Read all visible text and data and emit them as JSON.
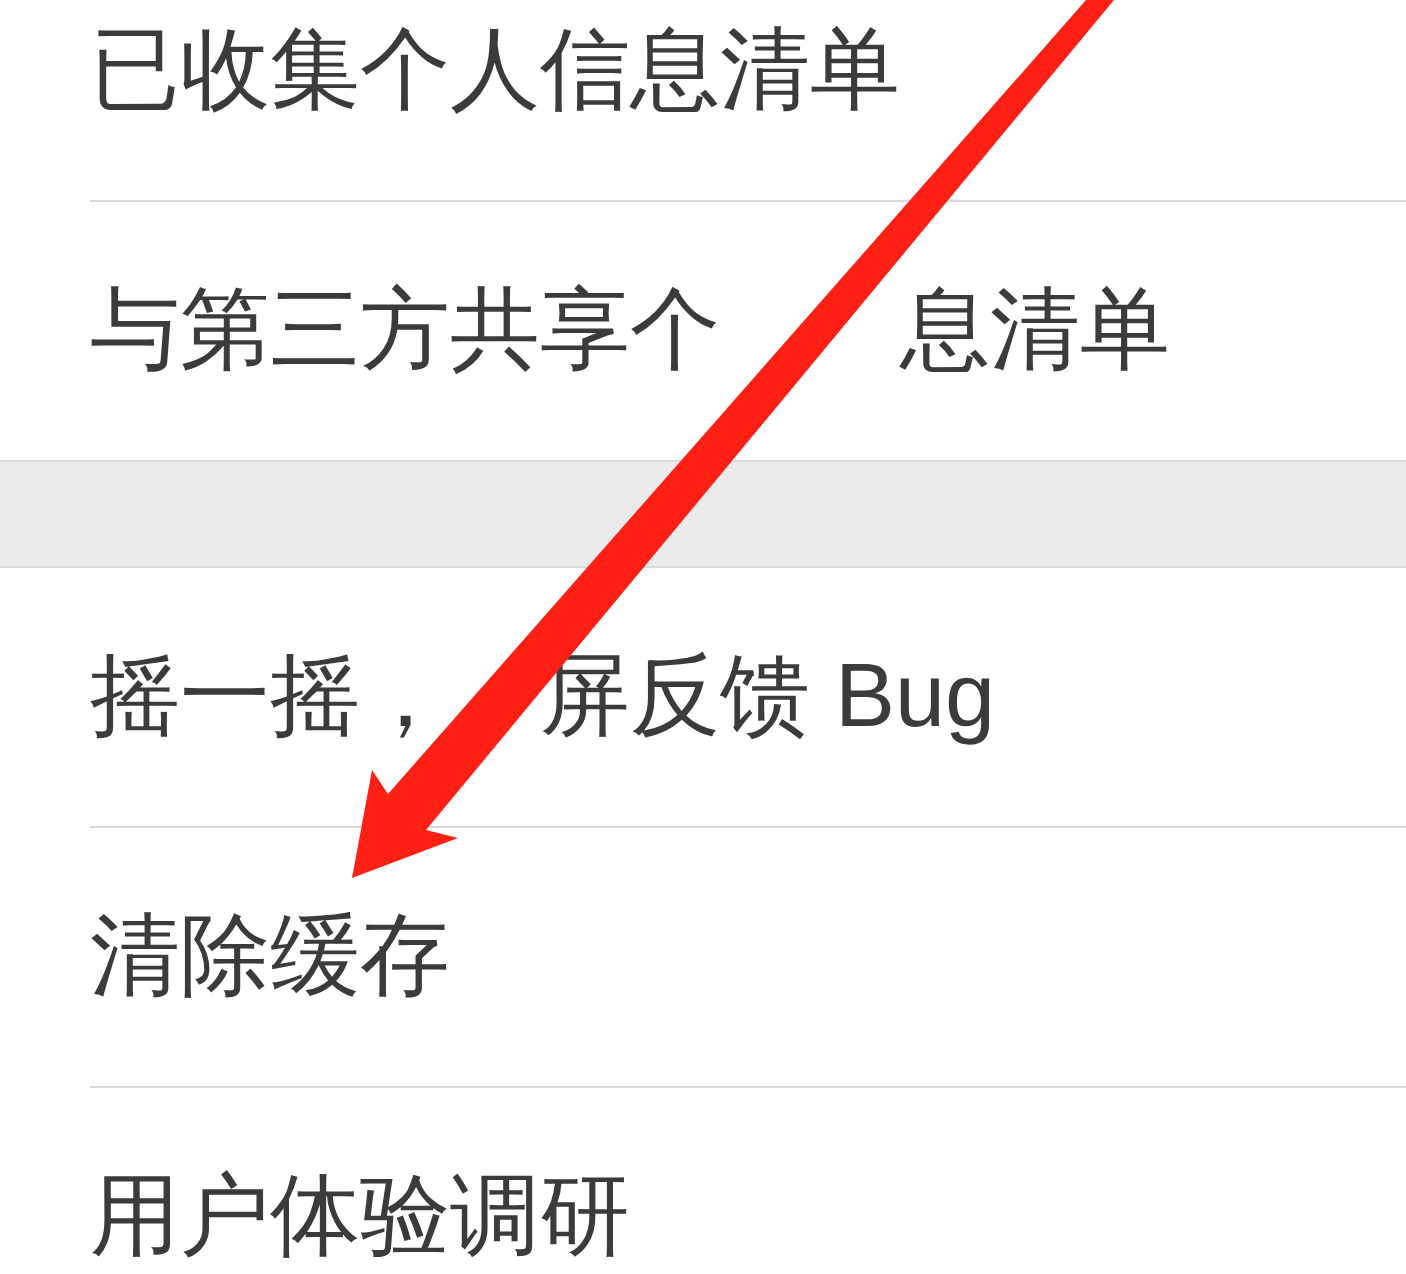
{
  "sections": [
    {
      "items": [
        {
          "label": "已收集个人信息清单"
        },
        {
          "label": "与第三方共享个　　息清单"
        }
      ]
    },
    {
      "items": [
        {
          "label": "摇一摇，　屏反馈 Bug"
        },
        {
          "label": "清除缓存"
        },
        {
          "label": "用户体验调研"
        }
      ]
    }
  ],
  "annotations": [
    {
      "kind": "arrow"
    }
  ]
}
